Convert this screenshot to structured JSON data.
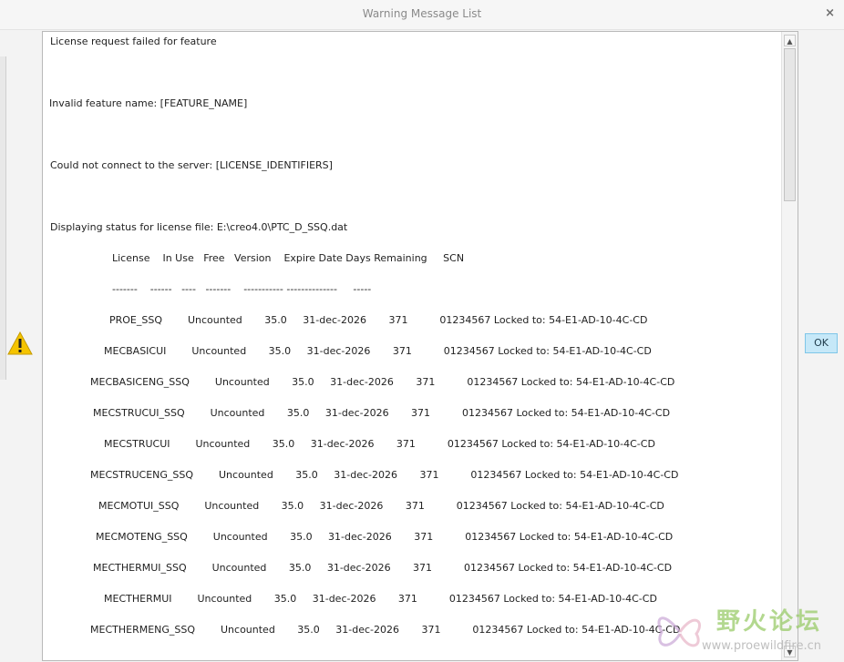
{
  "window": {
    "title": "Warning Message List",
    "close_glyph": "×"
  },
  "buttons": {
    "ok": "OK"
  },
  "icons": {
    "warning": "warning-triangle-icon",
    "close": "close-icon"
  },
  "colors": {
    "warning_fill": "#f5c400",
    "ok_bg": "#c6e8f8"
  },
  "messages": [
    "License request failed for feature",
    "Invalid feature name: [FEATURE_NAME]",
    "Could not connect to the server: [LICENSE_IDENTIFIERS]",
    "Displaying status for license file: E:\\creo4.0\\PTC_D_SSQ.dat"
  ],
  "table": {
    "header": "License    In Use   Free   Version    Expire Date Days Remaining     SCN",
    "separator": "-------    ------   ----   -------    ----------- --------------     -----",
    "rows": [
      "PROE_SSQ        Uncounted       35.0     31-dec-2026       371          01234567 Locked to: 54-E1-AD-10-4C-CD",
      "MECBASICUI        Uncounted       35.0     31-dec-2026       371          01234567 Locked to: 54-E1-AD-10-4C-CD",
      "MECBASICENG_SSQ        Uncounted       35.0     31-dec-2026       371          01234567 Locked to: 54-E1-AD-10-4C-CD",
      "MECSTRUCUI_SSQ        Uncounted       35.0     31-dec-2026       371          01234567 Locked to: 54-E1-AD-10-4C-CD",
      "MECSTRUCUI        Uncounted       35.0     31-dec-2026       371          01234567 Locked to: 54-E1-AD-10-4C-CD",
      "MECSTRUCENG_SSQ        Uncounted       35.0     31-dec-2026       371          01234567 Locked to: 54-E1-AD-10-4C-CD",
      "MECMOTUI_SSQ        Uncounted       35.0     31-dec-2026       371          01234567 Locked to: 54-E1-AD-10-4C-CD",
      "MECMOTENG_SSQ        Uncounted       35.0     31-dec-2026       371          01234567 Locked to: 54-E1-AD-10-4C-CD",
      "MECTHERMUI_SSQ        Uncounted       35.0     31-dec-2026       371          01234567 Locked to: 54-E1-AD-10-4C-CD",
      "MECTHERMUI        Uncounted       35.0     31-dec-2026       371          01234567 Locked to: 54-E1-AD-10-4C-CD",
      "MECTHERMENG_SSQ        Uncounted       35.0     31-dec-2026       371          01234567 Locked to: 54-E1-AD-10-4C-CD"
    ]
  },
  "watermark": {
    "title": "野火论坛",
    "url": "www.proewildfire.cn"
  }
}
